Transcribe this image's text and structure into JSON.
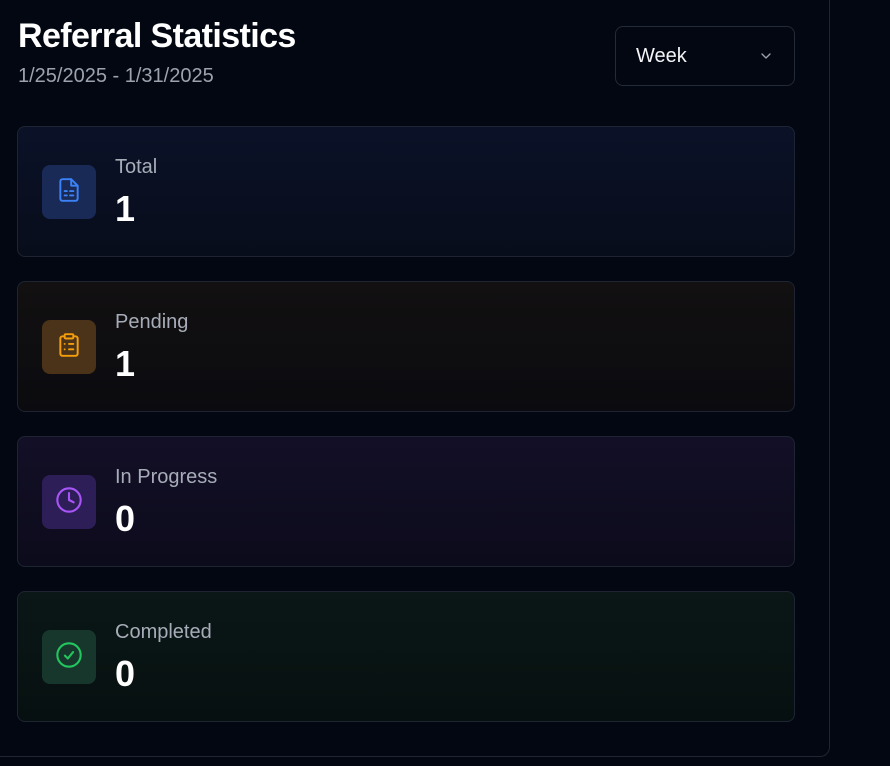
{
  "header": {
    "title": "Referral Statistics",
    "date_range": "1/25/2025 - 1/31/2025"
  },
  "period_select": {
    "value": "Week"
  },
  "stats": [
    {
      "label": "Total",
      "value": "1",
      "icon": "document-icon",
      "color": "#3b82f6"
    },
    {
      "label": "Pending",
      "value": "1",
      "icon": "clipboard-list-icon",
      "color": "#f59e0b"
    },
    {
      "label": "In Progress",
      "value": "0",
      "icon": "clock-icon",
      "color": "#a855f7"
    },
    {
      "label": "Completed",
      "value": "0",
      "icon": "check-circle-icon",
      "color": "#22c55e"
    }
  ]
}
